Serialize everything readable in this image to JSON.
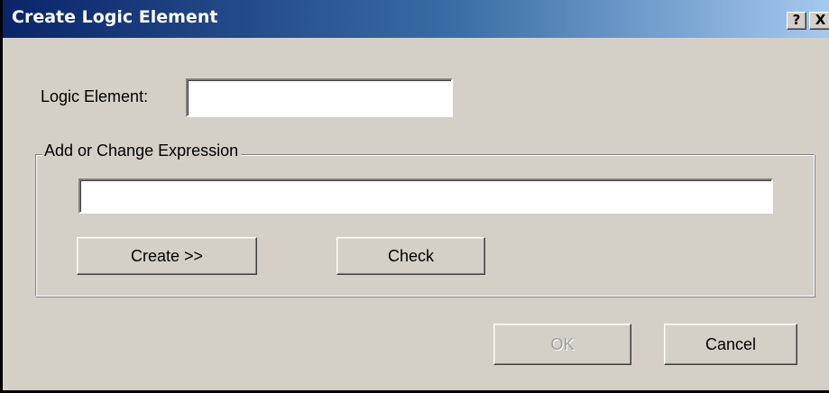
{
  "window": {
    "title": "Create Logic Element",
    "help_button": "?",
    "close_button": "X"
  },
  "form": {
    "logic_element_label": "Logic Element:",
    "logic_element_value": "",
    "group_label": "Add or Change Expression",
    "expression_value": ""
  },
  "buttons": {
    "create_label": "Create >>",
    "check_label": "Check",
    "ok_label": "OK",
    "ok_enabled": false,
    "cancel_label": "Cancel"
  }
}
